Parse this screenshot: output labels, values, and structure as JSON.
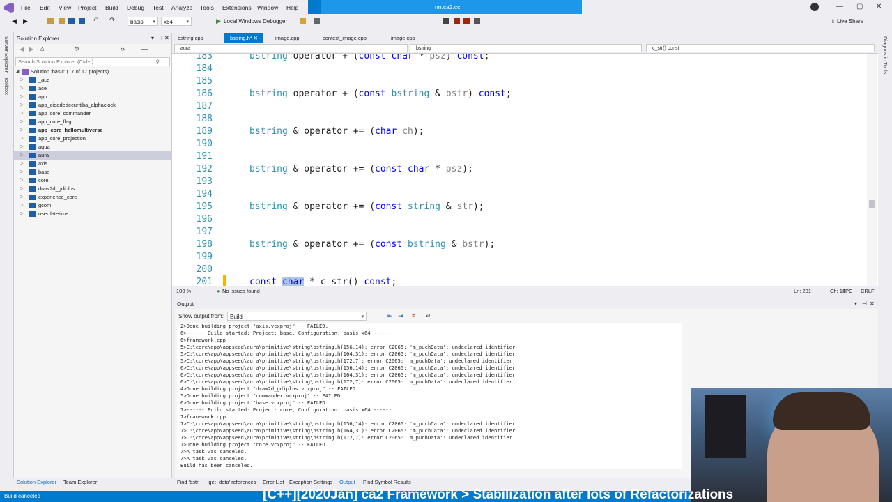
{
  "menu": [
    "File",
    "Edit",
    "View",
    "Project",
    "Build",
    "Debug",
    "Test",
    "Analyze",
    "Tools",
    "Extensions",
    "Window",
    "Help"
  ],
  "title_blue": "nn.ca2.cc",
  "live_share": "Live Share",
  "toolbar": {
    "config": "basis",
    "platform": "x64",
    "debugger": "Local Windows Debugger"
  },
  "solution_explorer": {
    "title": "Solution Explorer",
    "search_placeholder": "Search Solution Explorer (Ctrl+;)",
    "solution": "Solution 'basic' (17 of 17 projects)",
    "items": [
      {
        "label": "_ace",
        "bold": false
      },
      {
        "label": "ace",
        "bold": false
      },
      {
        "label": "app",
        "bold": false
      },
      {
        "label": "app_cidadedecuritiba_alphaclock",
        "bold": false
      },
      {
        "label": "app_core_commander",
        "bold": false
      },
      {
        "label": "app_core_flag",
        "bold": false
      },
      {
        "label": "app_core_hellomultiverse",
        "bold": true
      },
      {
        "label": "app_core_projection",
        "bold": false
      },
      {
        "label": "aqua",
        "bold": false
      },
      {
        "label": "aura",
        "bold": false,
        "selected": true
      },
      {
        "label": "axis",
        "bold": false
      },
      {
        "label": "base",
        "bold": false
      },
      {
        "label": "core",
        "bold": false
      },
      {
        "label": "draw2d_gdiplus",
        "bold": false
      },
      {
        "label": "experience_core",
        "bold": false
      },
      {
        "label": "gcom",
        "bold": false
      },
      {
        "label": "userdatetime",
        "bold": false
      }
    ]
  },
  "side_left": {
    "server_explorer": "Server Explorer",
    "toolbox": "Toolbox"
  },
  "side_right": {
    "diagnostic_tools": "Diagnostic Tools"
  },
  "editor": {
    "tabs": [
      "bstring.cpp",
      "bstring.h*",
      "image.cpp",
      "context_image.cpp",
      "image.cpp"
    ],
    "active_tab": 1,
    "nav_project": "aura",
    "nav_class": "bstring",
    "nav_member": "c_str() const",
    "lines": [
      {
        "n": "183",
        "html": "bstring operator + (const char * psz) const;"
      },
      {
        "n": "184",
        "html": ""
      },
      {
        "n": "185",
        "html": ""
      },
      {
        "n": "186",
        "html": "bstring operator + (const bstring & bstr) const;"
      },
      {
        "n": "187",
        "html": ""
      },
      {
        "n": "188",
        "html": ""
      },
      {
        "n": "189",
        "html": "bstring & operator += (char ch);"
      },
      {
        "n": "190",
        "html": ""
      },
      {
        "n": "191",
        "html": ""
      },
      {
        "n": "192",
        "html": "bstring & operator += (const char * psz);"
      },
      {
        "n": "193",
        "html": ""
      },
      {
        "n": "194",
        "html": ""
      },
      {
        "n": "195",
        "html": "bstring & operator += (const string & str);"
      },
      {
        "n": "196",
        "html": ""
      },
      {
        "n": "197",
        "html": ""
      },
      {
        "n": "198",
        "html": "bstring & operator += (const bstring & bstr);"
      },
      {
        "n": "199",
        "html": ""
      },
      {
        "n": "200",
        "html": ""
      },
      {
        "n": "201",
        "html": "const char * c_str() const;"
      }
    ],
    "zoom": "100 %",
    "issues": "No issues found",
    "ln": "Ln: 201",
    "ch": "Ch: 14",
    "spc": "SPC",
    "crlf": "CRLF"
  },
  "output": {
    "title": "Output",
    "show_from_label": "Show output from:",
    "show_from_value": "Build",
    "lines": [
      "2>Done building project \"axis.vcxproj\" -- FAILED.",
      "6>------ Build started: Project: base, Configuration: basis x64 ------",
      "6>framework.cpp",
      "5>C:\\core\\app\\appseed\\aura\\primitive\\string\\bstring.h(156,14): error C2065: 'm_puchData': undeclared identifier",
      "5>C:\\core\\app\\appseed\\aura\\primitive\\string\\bstring.h(164,31): error C2065: 'm_puchData': undeclared identifier",
      "5>C:\\core\\app\\appseed\\aura\\primitive\\string\\bstring.h(172,7): error C2065: 'm_puchData': undeclared identifier",
      "6>C:\\core\\app\\appseed\\aura\\primitive\\string\\bstring.h(156,14): error C2065: 'm_puchData': undeclared identifier",
      "6>C:\\core\\app\\appseed\\aura\\primitive\\string\\bstring.h(164,31): error C2065: 'm_puchData': undeclared identifier",
      "6>C:\\core\\app\\appseed\\aura\\primitive\\string\\bstring.h(172,7): error C2065: 'm_puchData': undeclared identifier",
      "4>Done building project \"draw2d_gdiplus.vcxproj\" -- FAILED.",
      "5>Done building project \"commander.vcxproj\" -- FAILED.",
      "6>Done building project \"base.vcxproj\" -- FAILED.",
      "7>------ Build started: Project: core, Configuration: basis x64 ------",
      "7>framework.cpp",
      "7>C:\\core\\app\\appseed\\aura\\primitive\\string\\bstring.h(156,14): error C2065: 'm_puchData': undeclared identifier",
      "7>C:\\core\\app\\appseed\\aura\\primitive\\string\\bstring.h(164,31): error C2065: 'm_puchData': undeclared identifier",
      "7>C:\\core\\app\\appseed\\aura\\primitive\\string\\bstring.h(172,7): error C2065: 'm_puchData': undeclared identifier",
      "7>Done building project \"core.vcxproj\" -- FAILED.",
      "7>A task was canceled.",
      "7>A task was canceled.",
      "Build has been canceled."
    ]
  },
  "bottom_tabs_left": [
    "Solution Explorer",
    "Team Explorer"
  ],
  "bottom_tabs_right": [
    "Find 'bstr'",
    "'get_data' references",
    "Error List",
    "Exception Settings",
    "Output",
    "Find Symbol Results"
  ],
  "status": "Build canceled",
  "caption": "[C++][2020Jan] ca2 Framework > Stabilization after lots of Refactorizations"
}
